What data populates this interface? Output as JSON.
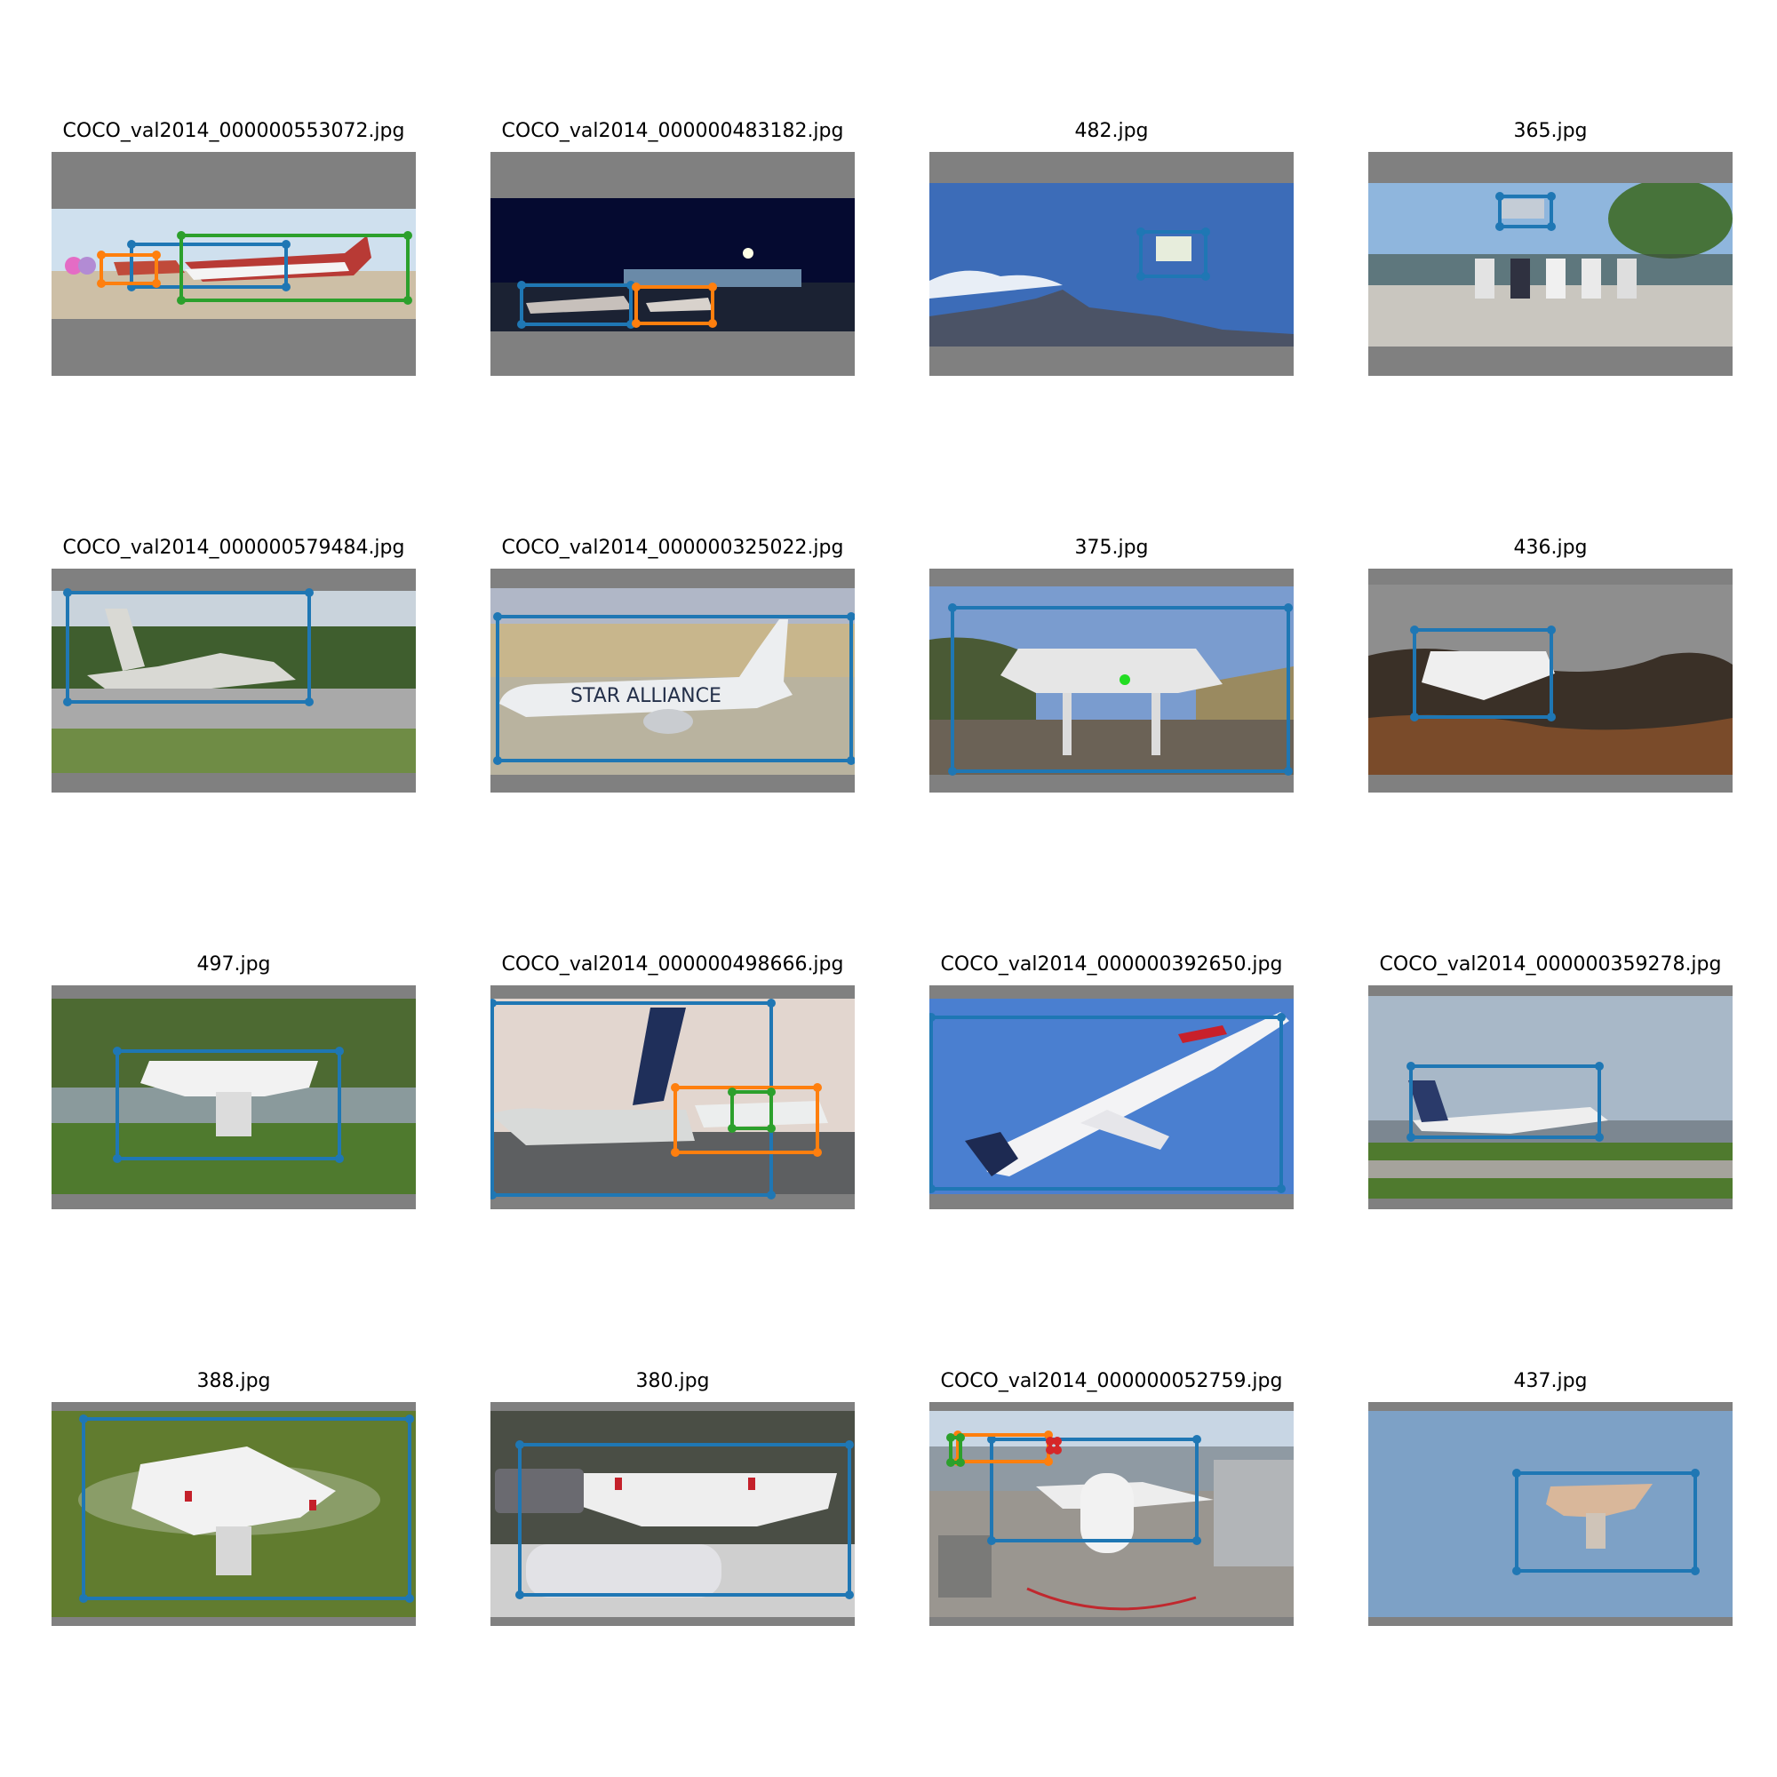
{
  "figure": {
    "colors": {
      "blue": "#1f77b4",
      "orange": "#ff7f0e",
      "green": "#2ca02c",
      "red": "#d62728",
      "letterbox": "#808080"
    },
    "tiles": [
      {
        "title": "COCO_val2014_000000553072.jpg",
        "scene": "jets-on-tarmac"
      },
      {
        "title": "COCO_val2014_000000483182.jpg",
        "scene": "airport-at-night"
      },
      {
        "title": "482.jpg",
        "scene": "drone-over-mountains"
      },
      {
        "title": "365.jpg",
        "scene": "people-sitting-drone-above"
      },
      {
        "title": "COCO_val2014_000000579484.jpg",
        "scene": "military-jet-on-runway"
      },
      {
        "title": "COCO_val2014_000000325022.jpg",
        "scene": "star-alliance-airliner"
      },
      {
        "title": "375.jpg",
        "scene": "drone-on-gravel"
      },
      {
        "title": "436.jpg",
        "scene": "drone-over-rocks"
      },
      {
        "title": "497.jpg",
        "scene": "drone-on-grass"
      },
      {
        "title": "COCO_val2014_000000498666.jpg",
        "scene": "united-airliners-at-gate"
      },
      {
        "title": "COCO_val2014_000000392650.jpg",
        "scene": "delta-jet-climbing"
      },
      {
        "title": "COCO_val2014_000000359278.jpg",
        "scene": "united-jet-landing"
      },
      {
        "title": "388.jpg",
        "scene": "drone-flying-over-grass"
      },
      {
        "title": "380.jpg",
        "scene": "drone-with-controller"
      },
      {
        "title": "COCO_val2014_000000052759.jpg",
        "scene": "airliner-at-gate"
      },
      {
        "title": "437.jpg",
        "scene": "drone-in-sky"
      }
    ]
  }
}
